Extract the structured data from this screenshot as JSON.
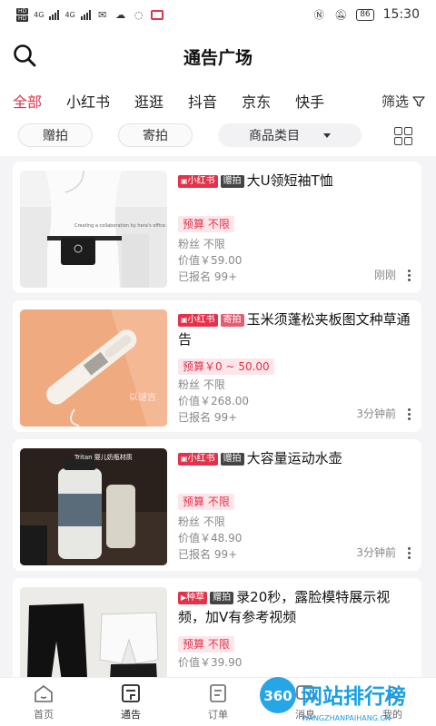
{
  "status_bar": {
    "hd1": "HD",
    "hd2": "HD",
    "net1": "4G",
    "net2": "4G",
    "battery": "86",
    "time": "15:30"
  },
  "header": {
    "title": "通告广场"
  },
  "platform_tabs": [
    "全部",
    "小红书",
    "逛逛",
    "抖音",
    "京东",
    "快手"
  ],
  "active_tab": 0,
  "filter_label": "筛选",
  "chips": {
    "gift": "赠拍",
    "send": "寄拍",
    "category": "商品类目"
  },
  "colors": {
    "accent": "#e3324a",
    "badge_dark": "#444444"
  },
  "cards": [
    {
      "platform": "小红书",
      "type": "赠拍",
      "title": "大U领短袖T恤",
      "budget": "预算 不限",
      "fans": "粉丝 不限",
      "price": "价值￥59.00",
      "signed": "已报名 99+",
      "time": "刚刚",
      "thumb_text": "Creating a collaboration by hera's office"
    },
    {
      "platform": "小红书",
      "type": "寄拍",
      "title": "玉米须蓬松夹板图文种草通告",
      "budget": "预算￥0 ~ 50.00",
      "fans": "粉丝 不限",
      "price": "价值￥268.00",
      "signed": "已报名 99+",
      "time": "3分钟前",
      "thumb_text": "以谜吉"
    },
    {
      "platform": "小红书",
      "type": "赠拍",
      "title": "大容量运动水壶",
      "budget": "预算 不限",
      "fans": "粉丝 不限",
      "price": "价值￥48.90",
      "signed": "已报名 99+",
      "time": "3分钟前",
      "thumb_text": "Tritan 婴儿奶瓶材质"
    },
    {
      "platform": "种草",
      "type": "赠拍",
      "title": "录20秒，露脸模特展示视频，加V有参考视频",
      "budget": "预算 不限",
      "fans": "",
      "price": "价值￥39.90",
      "signed": "",
      "time": "",
      "thumb_text": ""
    }
  ],
  "bottom_nav": [
    "首页",
    "通告",
    "订单",
    "消息",
    "我的"
  ],
  "active_nav": 1,
  "watermark": {
    "number": "360",
    "text": "网站排行榜",
    "url": "WANGZHANPAIHANG.CN"
  }
}
